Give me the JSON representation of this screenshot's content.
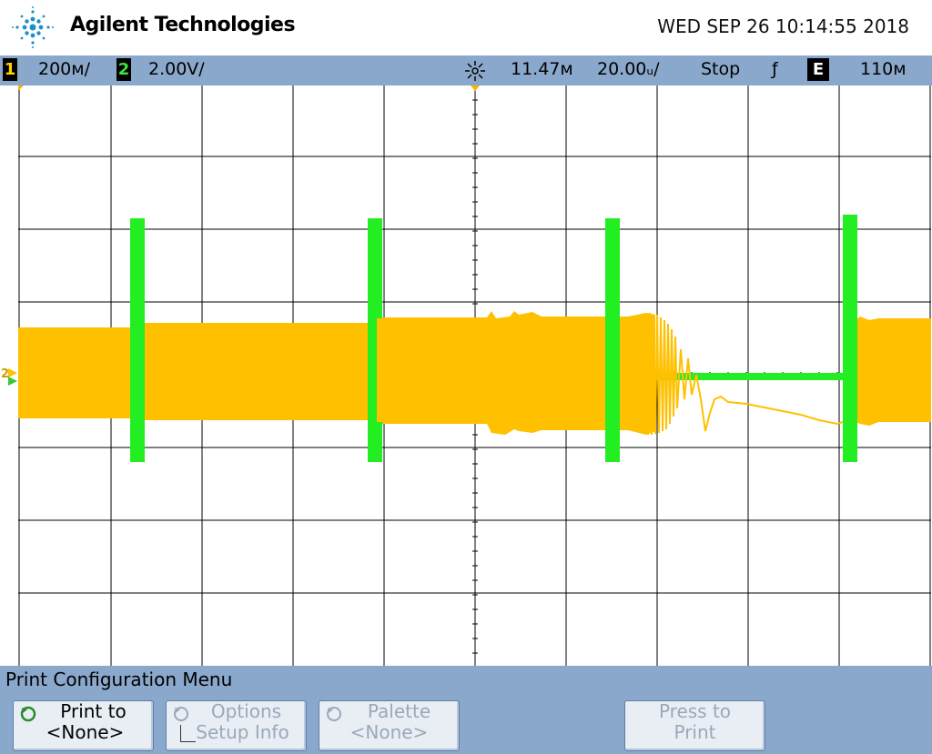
{
  "header": {
    "brand": "Agilent Technologies",
    "datetime": "WED SEP 26 10:14:55 2018"
  },
  "status": {
    "ch1_num": "1",
    "ch1_scale": "200ᴍ/",
    "ch2_num": "2",
    "ch2_scale": "2.00V/",
    "delay": "11.47ᴍ",
    "timebase": "20.00ᵤ/",
    "run_state": "Stop",
    "trigger_slope": "ƒ",
    "trigger_source": "E",
    "trigger_level": "110ᴍ"
  },
  "menu": {
    "title": "Print Configuration Menu",
    "buttons": [
      {
        "line1": "Print to",
        "line2": "<None>"
      },
      {
        "line1": "Options",
        "line2": "Setup Info"
      },
      {
        "line1": "Palette",
        "line2": "<None>"
      },
      {
        "line1": "Press to",
        "line2": "Print"
      }
    ]
  },
  "markers": {
    "ground_label": "2"
  },
  "colors": {
    "ch1": "#ffc000",
    "ch2": "#22ee22",
    "grid": "#000000",
    "bar": "#8aa8cc"
  }
}
